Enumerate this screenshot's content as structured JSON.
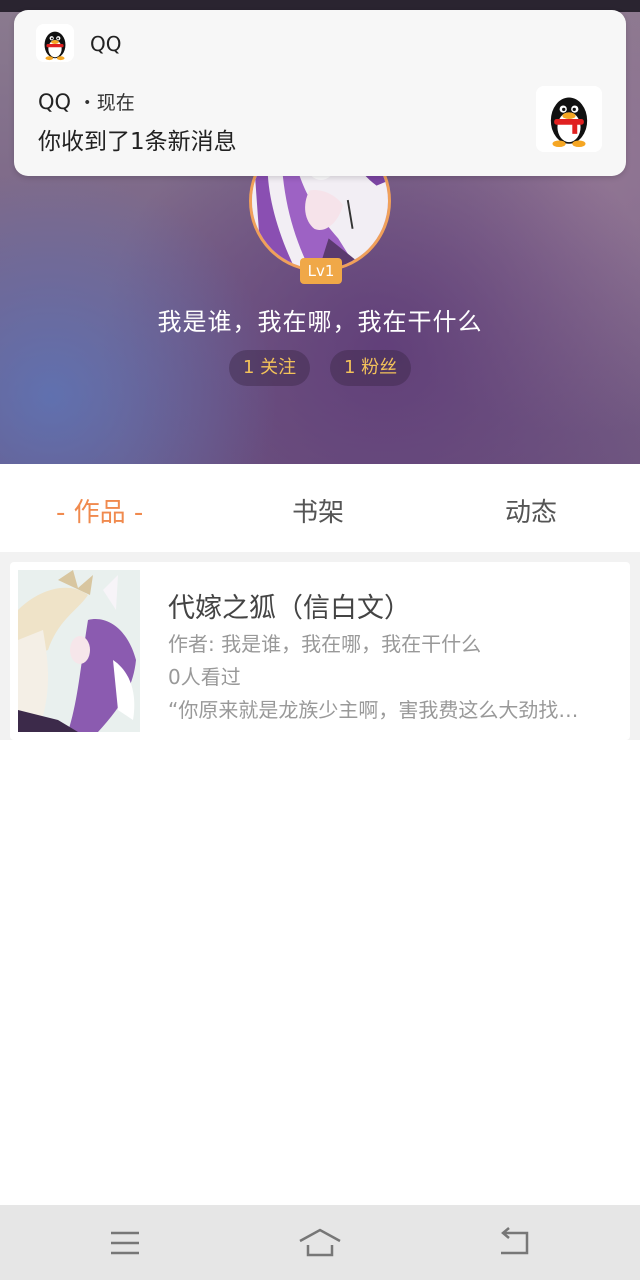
{
  "notification": {
    "app_name": "QQ",
    "title": "QQ",
    "time": "・现在",
    "message": "你收到了1条新消息",
    "icon": "qq-penguin-icon"
  },
  "profile": {
    "level": "Lv1",
    "username": "我是谁，我在哪，我在干什么",
    "follow_count": "1 关注",
    "fans_count": "1 粉丝"
  },
  "tabs": [
    {
      "label": "- 作品 -",
      "active": true
    },
    {
      "label": "书架",
      "active": false
    },
    {
      "label": "动态",
      "active": false
    }
  ],
  "books": [
    {
      "title": "代嫁之狐（信白文）",
      "author": "作者: 我是谁，我在哪，我在干什么",
      "views": "0人看过",
      "excerpt": "“你原来就是龙族少主啊，害我费这么大劲找…"
    }
  ],
  "nav": {
    "menu_icon": "menu-icon",
    "home_icon": "home-icon",
    "back_icon": "back-icon"
  },
  "colors": {
    "accent": "#f08a4e",
    "stat_text": "#f3c25a",
    "level_badge": "#f0a848",
    "avatar_ring": "#f0a05a"
  }
}
